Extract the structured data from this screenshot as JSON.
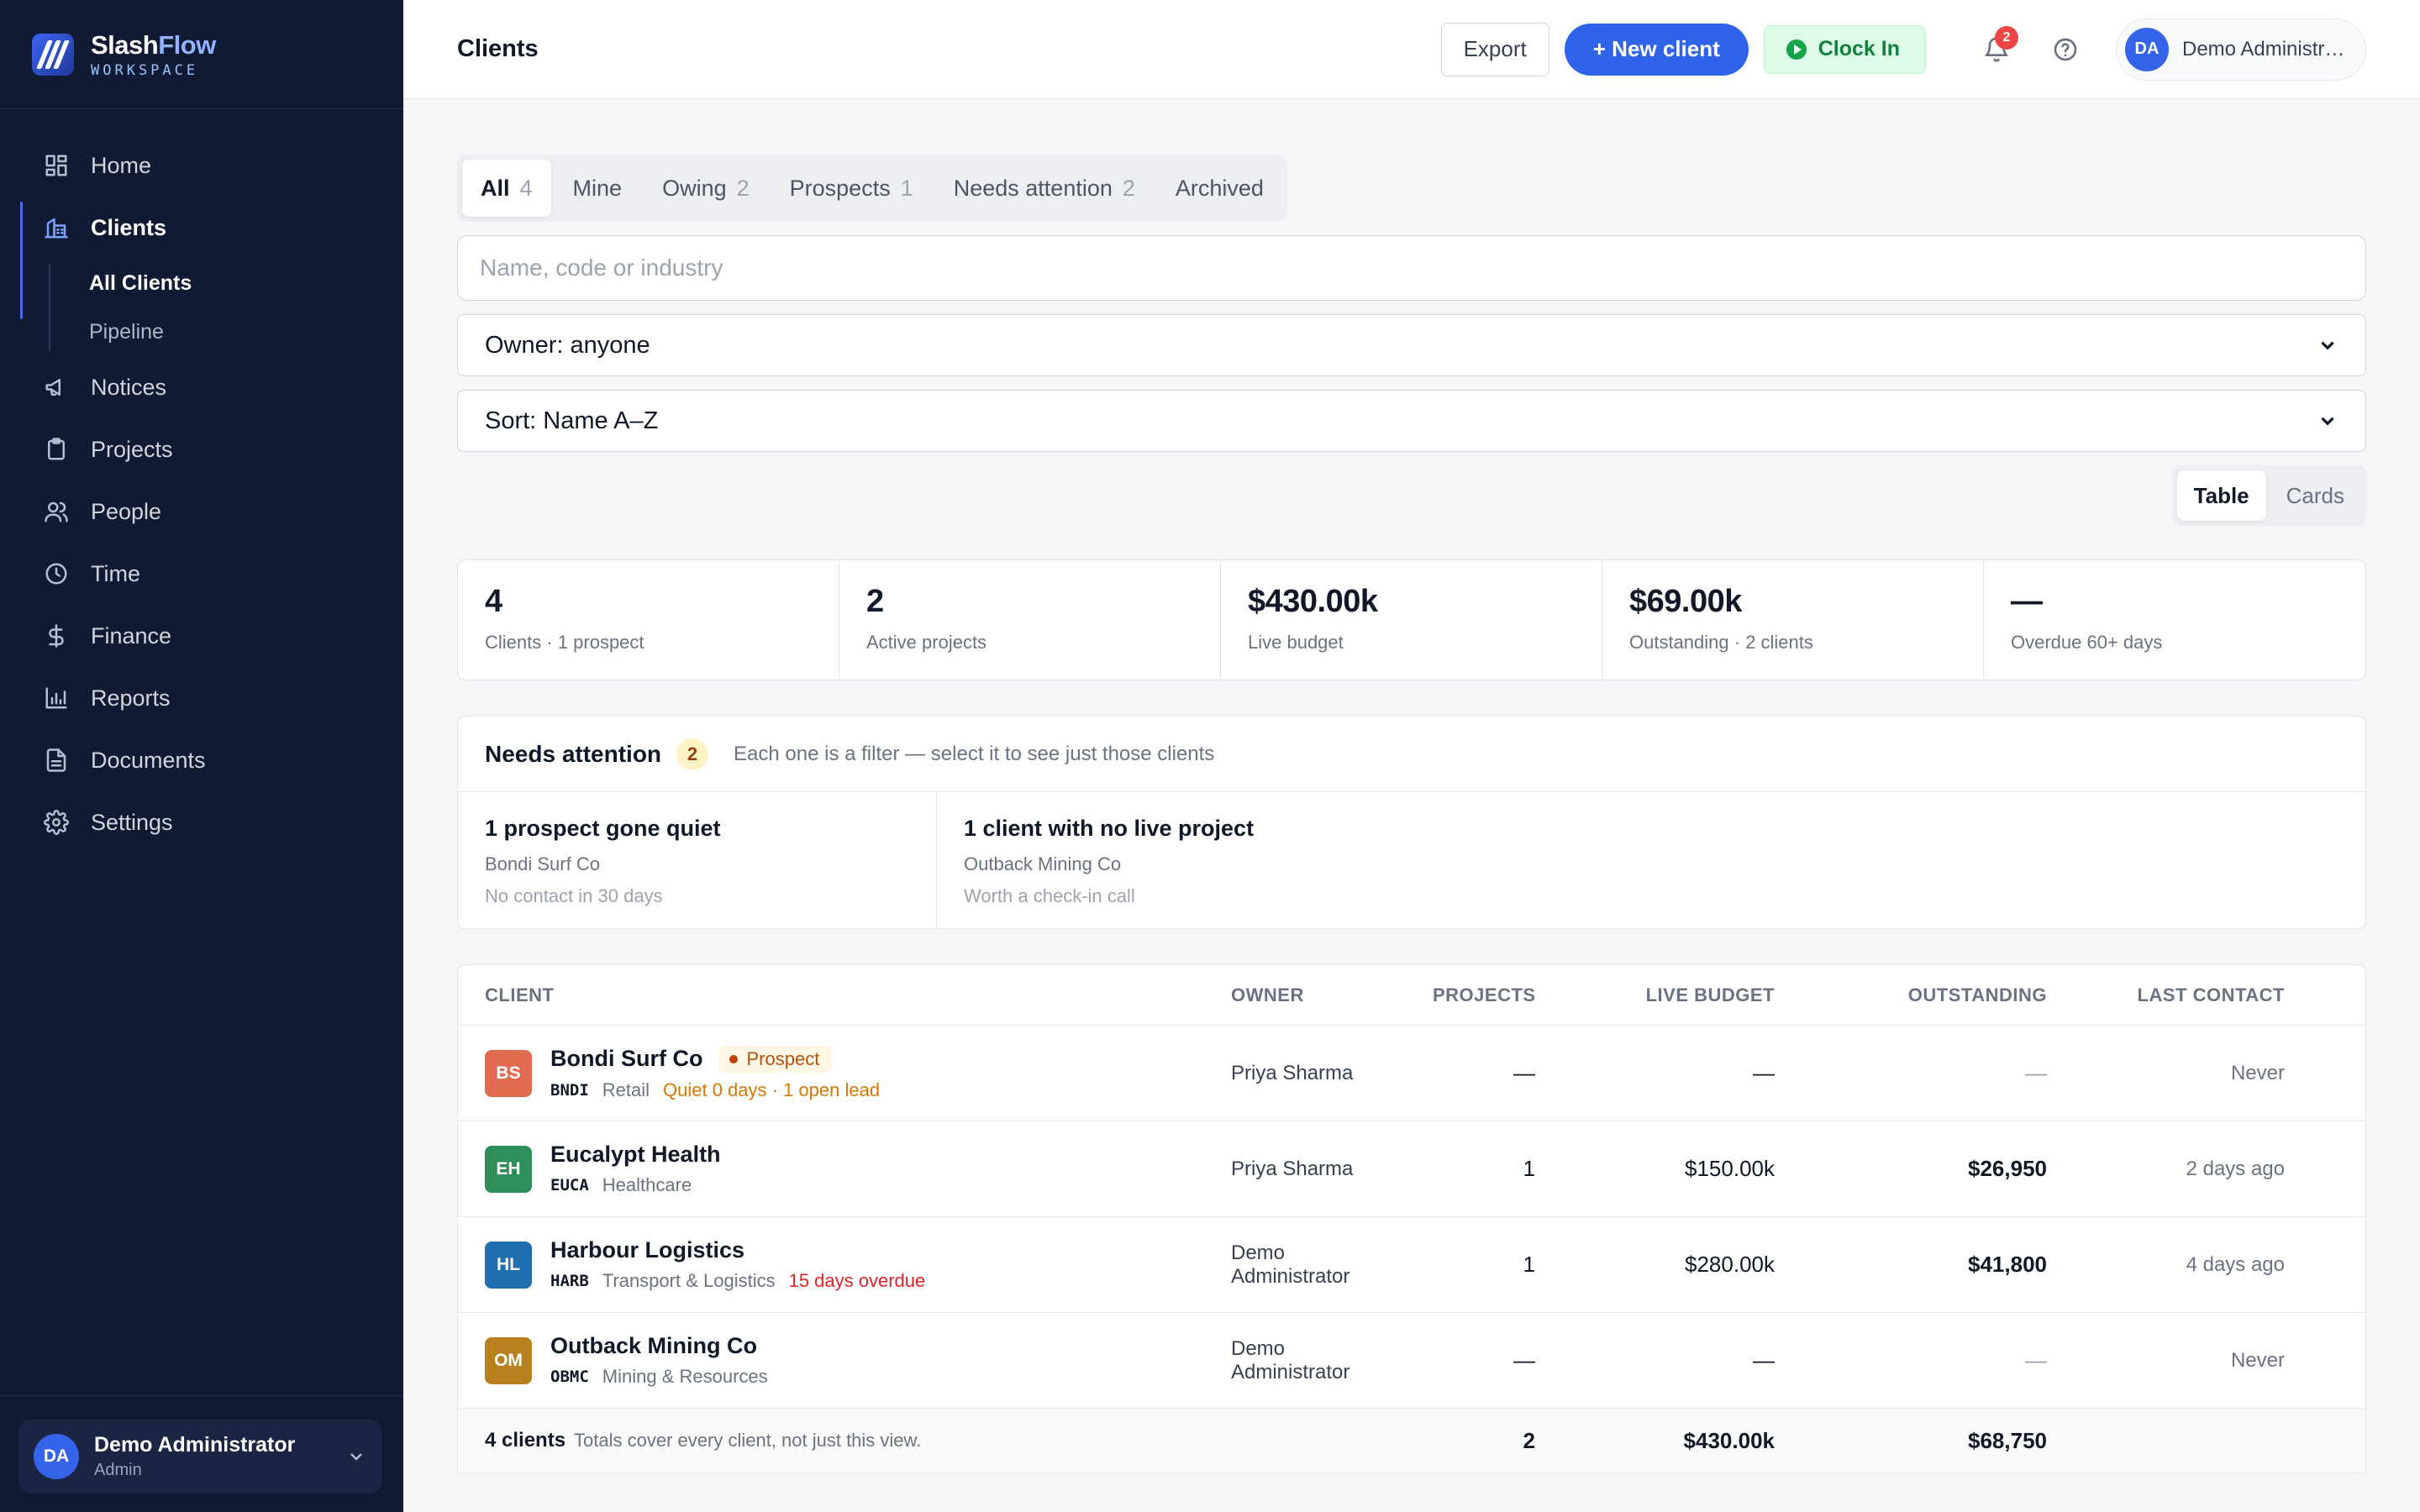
{
  "brand": {
    "name_a": "Slash",
    "name_b": "Flow",
    "subtitle": "WORKSPACE"
  },
  "nav": {
    "home": "Home",
    "clients": "Clients",
    "all_clients": "All Clients",
    "pipeline": "Pipeline",
    "notices": "Notices",
    "projects": "Projects",
    "people": "People",
    "time": "Time",
    "finance": "Finance",
    "reports": "Reports",
    "documents": "Documents",
    "settings": "Settings"
  },
  "sidebar_user": {
    "initials": "DA",
    "name": "Demo Administrator",
    "role": "Admin"
  },
  "header": {
    "title": "Clients",
    "export": "Export",
    "new_client": "+ New client",
    "clock_in": "Clock In",
    "notifications": "2",
    "user_initials": "DA",
    "user_name": "Demo Administrator"
  },
  "tabs": [
    {
      "label": "All",
      "count": "4"
    },
    {
      "label": "Mine",
      "count": ""
    },
    {
      "label": "Owing",
      "count": "2"
    },
    {
      "label": "Prospects",
      "count": "1"
    },
    {
      "label": "Needs attention",
      "count": "2"
    },
    {
      "label": "Archived",
      "count": ""
    }
  ],
  "filters": {
    "search_placeholder": "Name, code or industry",
    "owner": "Owner: anyone",
    "sort": "Sort: Name A–Z",
    "view_table": "Table",
    "view_cards": "Cards"
  },
  "stats": [
    {
      "value": "4",
      "label": "Clients · 1 prospect"
    },
    {
      "value": "2",
      "label": "Active projects"
    },
    {
      "value": "$430.00k",
      "label": "Live budget"
    },
    {
      "value": "$69.00k",
      "label": "Outstanding · 2 clients"
    },
    {
      "value": "—",
      "label": "Overdue 60+ days"
    }
  ],
  "attention": {
    "title": "Needs attention",
    "count": "2",
    "description": "Each one is a filter — select it to see just those clients",
    "cards": [
      {
        "title": "1 prospect gone quiet",
        "subject": "Bondi Surf Co",
        "note": "No contact in 30 days"
      },
      {
        "title": "1 client with no live project",
        "subject": "Outback Mining Co",
        "note": "Worth a check-in call"
      }
    ]
  },
  "table": {
    "headers": {
      "client": "CLIENT",
      "owner": "OWNER",
      "projects": "PROJECTS",
      "live_budget": "LIVE BUDGET",
      "outstanding": "OUTSTANDING",
      "last_contact": "LAST CONTACT"
    },
    "rows": [
      {
        "initials": "BS",
        "color": "#e06b4f",
        "name": "Bondi Surf Co",
        "tag": "Prospect",
        "code": "BNDI",
        "industry": "Retail",
        "flag": "Quiet 0 days · 1 open lead",
        "owner": "Priya Sharma",
        "projects": "—",
        "budget": "—",
        "outstanding": "—",
        "last_contact": "Never"
      },
      {
        "initials": "EH",
        "color": "#2f8f5b",
        "name": "Eucalypt Health",
        "tag": "",
        "code": "EUCA",
        "industry": "Healthcare",
        "flag": "",
        "owner": "Priya Sharma",
        "projects": "1",
        "budget": "$150.00k",
        "outstanding": "$26,950",
        "last_contact": "2 days ago"
      },
      {
        "initials": "HL",
        "color": "#1f6fb0",
        "name": "Harbour Logistics",
        "tag": "",
        "code": "HARB",
        "industry": "Transport & Logistics",
        "flag": "15 days overdue",
        "owner": "Demo Administrator",
        "projects": "1",
        "budget": "$280.00k",
        "outstanding": "$41,800",
        "last_contact": "4 days ago"
      },
      {
        "initials": "OM",
        "color": "#b8801f",
        "name": "Outback Mining Co",
        "tag": "",
        "code": "OBMC",
        "industry": "Mining & Resources",
        "flag": "",
        "owner": "Demo Administrator",
        "projects": "—",
        "budget": "—",
        "outstanding": "—",
        "last_contact": "Never"
      }
    ],
    "footer": {
      "count": "4 clients",
      "note": "Totals cover every client, not just this view.",
      "projects": "2",
      "budget": "$430.00k",
      "outstanding": "$68,750"
    }
  }
}
